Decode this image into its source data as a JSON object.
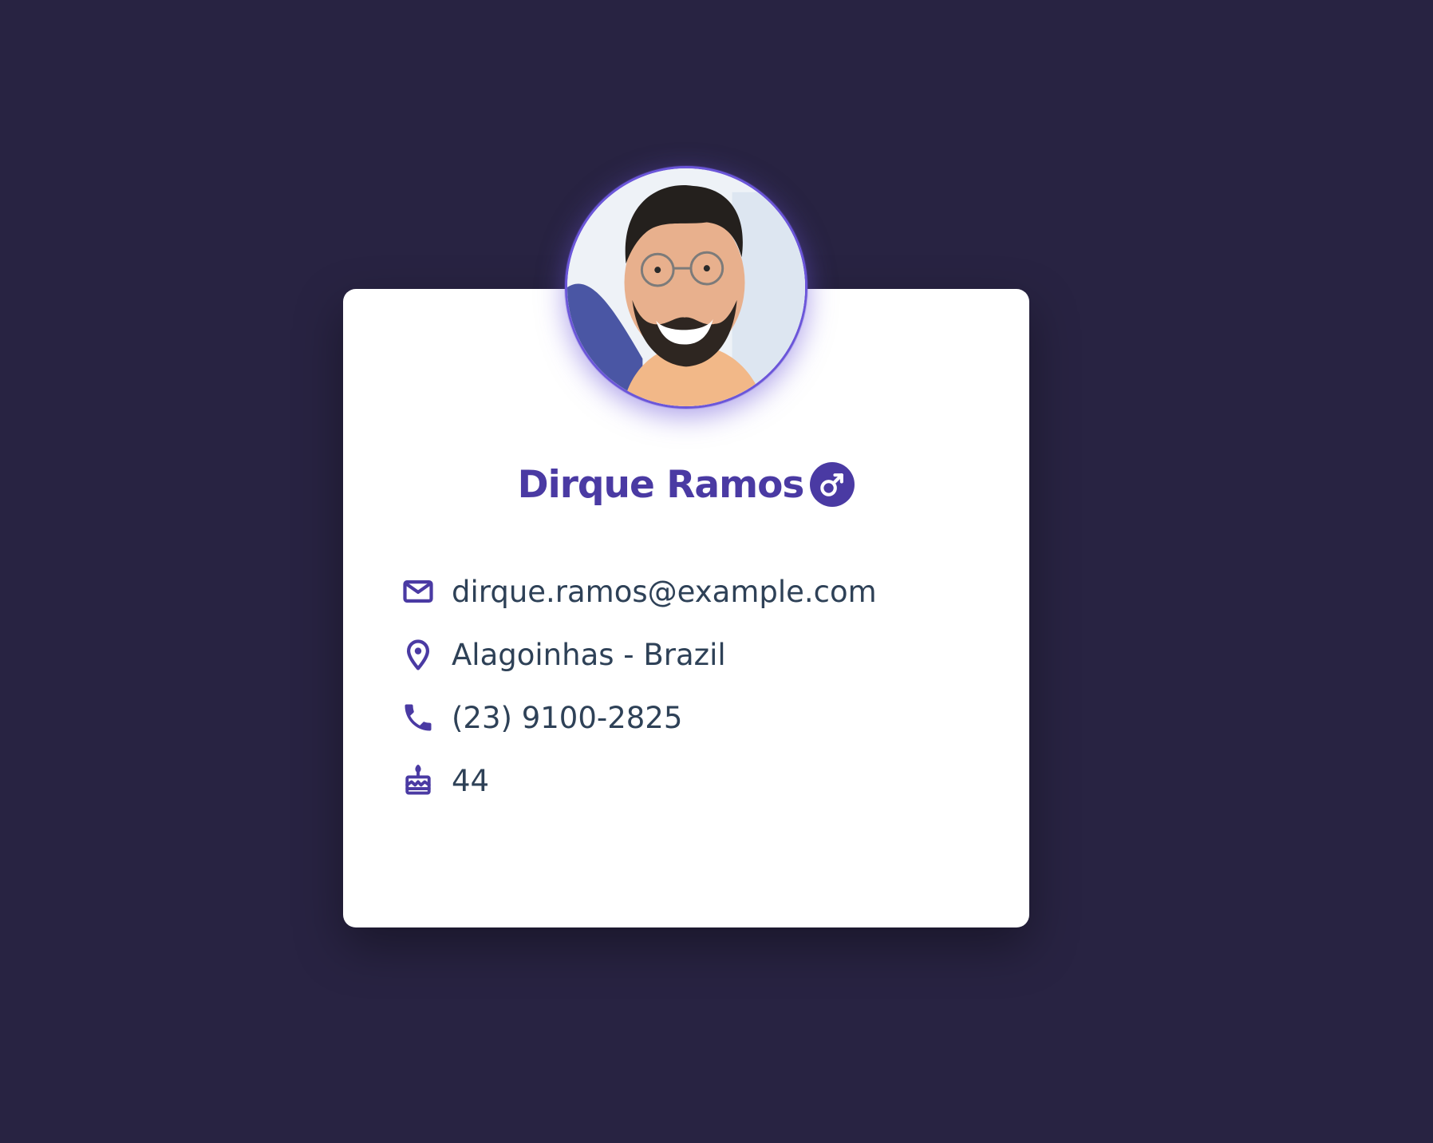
{
  "profile": {
    "name": "Dirque Ramos",
    "gender_icon": "male-symbol-icon",
    "avatar_icon": "user-avatar-photo"
  },
  "details": {
    "email": "dirque.ramos@example.com",
    "location": "Alagoinhas - Brazil",
    "phone": "(23) 9100-2825",
    "age": "44"
  },
  "colors": {
    "background": "#282342",
    "card": "#ffffff",
    "accent": "#4a3aa3",
    "text": "#2e4157",
    "avatar_ring": "#6b56d9"
  },
  "icons": {
    "email": "mail-icon",
    "location": "map-pin-icon",
    "phone": "phone-icon",
    "age": "birthday-cake-icon"
  }
}
